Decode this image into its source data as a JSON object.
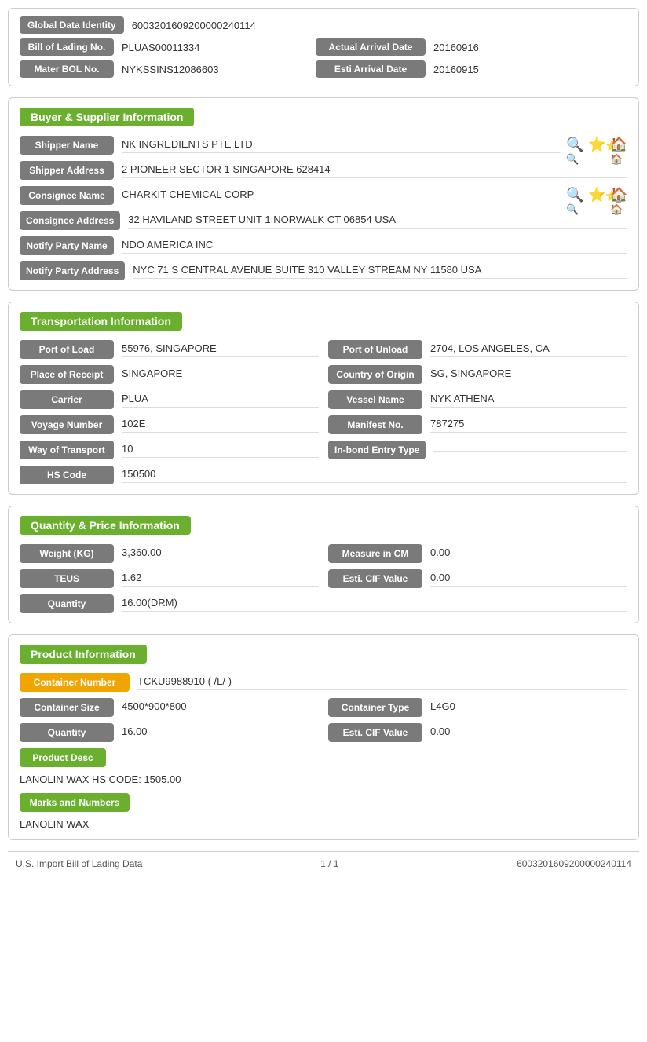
{
  "header": {
    "global_data_identity_label": "Global Data Identity",
    "global_data_identity_value": "6003201609200000240114",
    "bill_of_lading_label": "Bill of Lading No.",
    "bill_of_lading_value": "PLUAS00011334",
    "actual_arrival_date_label": "Actual Arrival Date",
    "actual_arrival_date_value": "20160916",
    "mater_bol_label": "Mater BOL No.",
    "mater_bol_value": "NYKSSINS12086603",
    "esti_arrival_date_label": "Esti Arrival Date",
    "esti_arrival_date_value": "20160915"
  },
  "buyer_supplier": {
    "title": "Buyer & Supplier Information",
    "shipper_name_label": "Shipper Name",
    "shipper_name_value": "NK INGREDIENTS PTE LTD",
    "shipper_address_label": "Shipper Address",
    "shipper_address_value": "2 PIONEER SECTOR 1 SINGAPORE 628414",
    "consignee_name_label": "Consignee Name",
    "consignee_name_value": "CHARKIT CHEMICAL CORP",
    "consignee_address_label": "Consignee Address",
    "consignee_address_value": "32 HAVILAND STREET UNIT 1 NORWALK CT 06854 USA",
    "notify_party_name_label": "Notify Party Name",
    "notify_party_name_value": "NDO AMERICA INC",
    "notify_party_address_label": "Notify Party Address",
    "notify_party_address_value": "NYC 71 S CENTRAL AVENUE SUITE 310 VALLEY STREAM NY 11580 USA"
  },
  "transportation": {
    "title": "Transportation Information",
    "port_of_load_label": "Port of Load",
    "port_of_load_value": "55976, SINGAPORE",
    "port_of_unload_label": "Port of Unload",
    "port_of_unload_value": "2704, LOS ANGELES, CA",
    "place_of_receipt_label": "Place of Receipt",
    "place_of_receipt_value": "SINGAPORE",
    "country_of_origin_label": "Country of Origin",
    "country_of_origin_value": "SG, SINGAPORE",
    "carrier_label": "Carrier",
    "carrier_value": "PLUA",
    "vessel_name_label": "Vessel Name",
    "vessel_name_value": "NYK ATHENA",
    "voyage_number_label": "Voyage Number",
    "voyage_number_value": "102E",
    "manifest_no_label": "Manifest No.",
    "manifest_no_value": "787275",
    "way_of_transport_label": "Way of Transport",
    "way_of_transport_value": "10",
    "in_bond_entry_type_label": "In-bond Entry Type",
    "in_bond_entry_type_value": "",
    "hs_code_label": "HS Code",
    "hs_code_value": "150500"
  },
  "quantity_price": {
    "title": "Quantity & Price Information",
    "weight_kg_label": "Weight (KG)",
    "weight_kg_value": "3,360.00",
    "measure_in_cm_label": "Measure in CM",
    "measure_in_cm_value": "0.00",
    "teus_label": "TEUS",
    "teus_value": "1.62",
    "esti_cif_value_label": "Esti. CIF Value",
    "esti_cif_value_value": "0.00",
    "quantity_label": "Quantity",
    "quantity_value": "16.00(DRM)"
  },
  "product": {
    "title": "Product Information",
    "container_number_label": "Container Number",
    "container_number_value": "TCKU9988910 ( /L/ )",
    "container_size_label": "Container Size",
    "container_size_value": "4500*900*800",
    "container_type_label": "Container Type",
    "container_type_value": "L4G0",
    "quantity_label": "Quantity",
    "quantity_value": "16.00",
    "esti_cif_value_label": "Esti. CIF Value",
    "esti_cif_value_value": "0.00",
    "product_desc_label": "Product Desc",
    "product_desc_value": "LANOLIN WAX HS CODE: 1505.00",
    "marks_and_numbers_label": "Marks and Numbers",
    "marks_and_numbers_value": "LANOLIN WAX"
  },
  "footer": {
    "left": "U.S. Import Bill of Lading Data",
    "center": "1 / 1",
    "right": "6003201609200000240114"
  }
}
